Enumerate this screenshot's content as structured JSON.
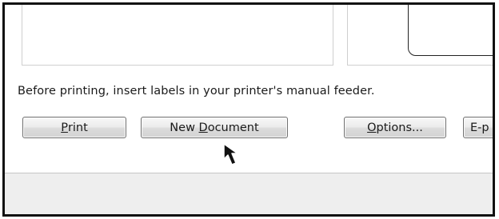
{
  "hint_text": "Before printing, insert labels in your printer's manual feeder.",
  "buttons": {
    "print": {
      "mnemonic": "P",
      "rest": "rint"
    },
    "new_document": {
      "before": "New ",
      "mnemonic": "D",
      "rest": "ocument"
    },
    "options": {
      "mnemonic": "O",
      "rest": "ptions..."
    },
    "email": {
      "label": "E-p"
    }
  },
  "icons": {
    "cursor": "arrow-pointer-icon"
  },
  "colors": {
    "footer_bg": "#eeeeee",
    "button_border": "#707070",
    "frame_border": "#111111"
  }
}
